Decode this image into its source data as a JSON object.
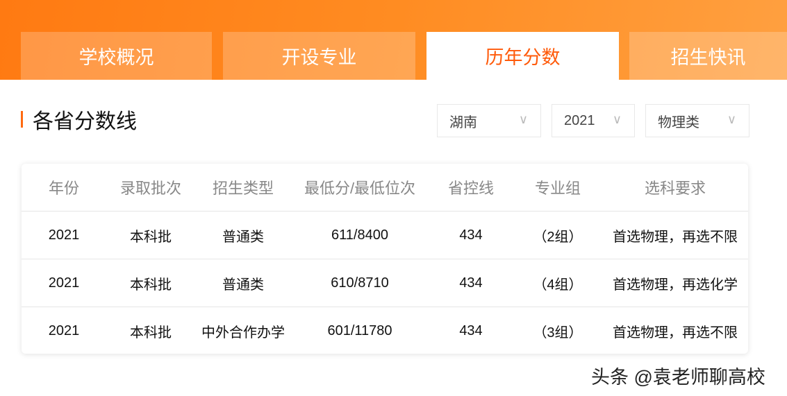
{
  "tabs": [
    {
      "label": "学校概况",
      "active": false
    },
    {
      "label": "开设专业",
      "active": false
    },
    {
      "label": "历年分数",
      "active": true
    },
    {
      "label": "招生快讯",
      "active": false
    }
  ],
  "section": {
    "title": "各省分数线"
  },
  "filters": {
    "province": "湖南",
    "year": "2021",
    "subject": "物理类",
    "chevron": "∨"
  },
  "table": {
    "headers": [
      "年份",
      "录取批次",
      "招生类型",
      "最低分/最低位次",
      "省控线",
      "专业组",
      "选科要求"
    ],
    "rows": [
      [
        "2021",
        "本科批",
        "普通类",
        "611/8400",
        "434",
        "（2组）",
        "首选物理，再选不限"
      ],
      [
        "2021",
        "本科批",
        "普通类",
        "610/8710",
        "434",
        "（4组）",
        "首选物理，再选化学"
      ],
      [
        "2021",
        "本科批",
        "中外合作办学",
        "601/11780",
        "434",
        "（3组）",
        "首选物理，再选不限"
      ]
    ]
  },
  "watermark": "头条 @袁老师聊高校",
  "colors": {
    "accent": "#ff5a0a",
    "header": "#ff8c22"
  }
}
